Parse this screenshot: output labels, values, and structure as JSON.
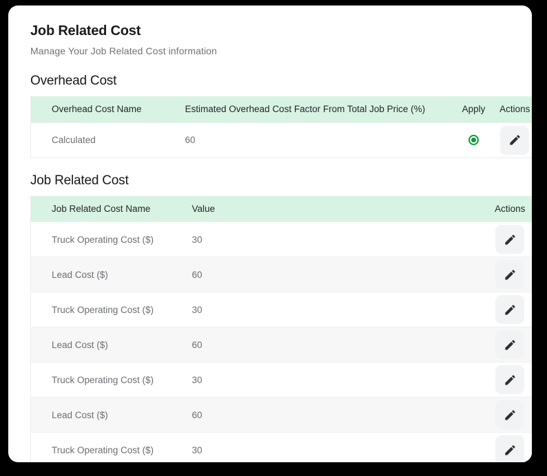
{
  "header": {
    "title": "Job Related Cost",
    "subtitle": "Manage Your Job Related Cost information"
  },
  "colors": {
    "table_header_bg": "#d8f3e3",
    "radio_selected": "#0a9c3c",
    "row_alt_bg": "#f7f7f7",
    "icon_button_bg": "#f1f3f4",
    "card_bg": "#ffffff",
    "page_bg": "#000000"
  },
  "overhead_section": {
    "heading": "Overhead Cost",
    "columns": [
      "Overhead Cost Name",
      "Estimated Overhead Cost Factor From Total Job Price (%)",
      "Apply",
      "Actions"
    ],
    "rows": [
      {
        "name": "Calculated",
        "factor": "60",
        "apply_selected": true,
        "apply_icon": "radio-selected-icon",
        "action_icon": "pencil-edit-icon"
      }
    ]
  },
  "job_related_section": {
    "heading": "Job Related Cost",
    "columns": [
      "Job Related Cost Name",
      "Value",
      "Actions"
    ],
    "rows": [
      {
        "name": "Truck Operating Cost ($)",
        "value": "30",
        "action_icon": "pencil-edit-icon"
      },
      {
        "name": "Lead Cost ($)",
        "value": "60",
        "action_icon": "pencil-edit-icon"
      },
      {
        "name": "Truck Operating Cost ($)",
        "value": "30",
        "action_icon": "pencil-edit-icon"
      },
      {
        "name": "Lead Cost ($)",
        "value": "60",
        "action_icon": "pencil-edit-icon"
      },
      {
        "name": "Truck Operating Cost ($)",
        "value": "30",
        "action_icon": "pencil-edit-icon"
      },
      {
        "name": "Lead Cost ($)",
        "value": "60",
        "action_icon": "pencil-edit-icon"
      },
      {
        "name": "Truck Operating Cost ($)",
        "value": "30",
        "action_icon": "pencil-edit-icon"
      }
    ]
  }
}
